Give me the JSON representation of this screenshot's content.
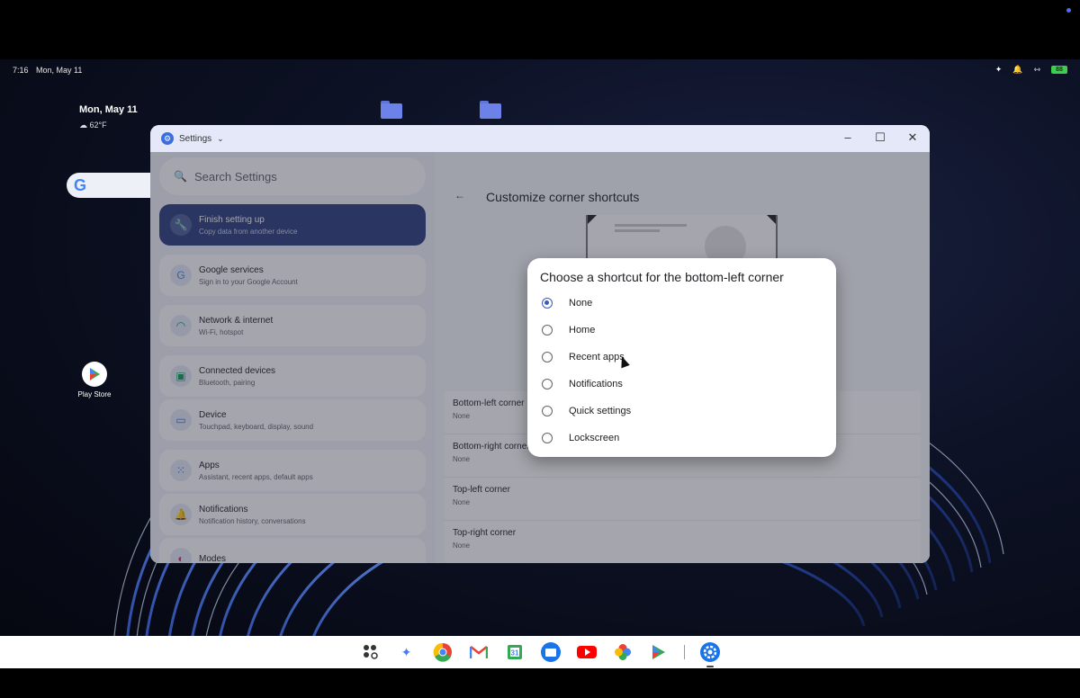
{
  "status_bar": {
    "time": "7:16",
    "date": "Mon, May 11",
    "battery": "88"
  },
  "desktop": {
    "widget_date": "Mon, May 11",
    "weather": "62°F",
    "play_store_label": "Play Store"
  },
  "window": {
    "app_name": "Settings",
    "search_placeholder": "Search Settings",
    "sidebar": [
      {
        "title": "Finish setting up",
        "subtitle": "Copy data from another device",
        "icon": "wrench-icon",
        "color": "#6a7bb8",
        "active": true
      },
      {
        "title": "Google services",
        "subtitle": "Sign in to your Google Account",
        "icon": "google-icon",
        "color": "#4285f4"
      },
      {
        "title": "Network & internet",
        "subtitle": "Wi-Fi, hotspot",
        "icon": "wifi-icon",
        "color": "#0f9d58"
      },
      {
        "title": "Connected devices",
        "subtitle": "Bluetooth, pairing",
        "icon": "devices-icon",
        "color": "#0f9d58"
      },
      {
        "title": "Device",
        "subtitle": "Touchpad, keyboard, display, sound",
        "icon": "laptop-icon",
        "color": "#3b6fe0"
      },
      {
        "title": "Apps",
        "subtitle": "Assistant, recent apps, default apps",
        "icon": "apps-icon",
        "color": "#3b6fe0"
      },
      {
        "title": "Notifications",
        "subtitle": "Notification history, conversations",
        "icon": "bell-icon",
        "color": "#d0306a"
      },
      {
        "title": "Modes",
        "subtitle": "",
        "icon": "modes-icon",
        "color": "#d0306a"
      }
    ],
    "page_title": "Customize corner shortcuts",
    "corners": [
      {
        "title": "Bottom-left corner",
        "value": "None"
      },
      {
        "title": "Bottom-right corner",
        "value": "None"
      },
      {
        "title": "Top-left corner",
        "value": "None"
      },
      {
        "title": "Top-right corner",
        "value": "None"
      }
    ]
  },
  "dialog": {
    "title": "Choose a shortcut for the bottom-left corner",
    "options": [
      {
        "label": "None",
        "checked": true
      },
      {
        "label": "Home",
        "checked": false
      },
      {
        "label": "Recent apps",
        "checked": false
      },
      {
        "label": "Notifications",
        "checked": false
      },
      {
        "label": "Quick settings",
        "checked": false
      },
      {
        "label": "Lockscreen",
        "checked": false
      }
    ]
  },
  "shelf": [
    "launcher-icon",
    "gemini-icon",
    "chrome-icon",
    "gmail-icon",
    "calendar-icon",
    "files-icon",
    "youtube-icon",
    "photos-icon",
    "play-store-icon",
    "settings-icon"
  ]
}
